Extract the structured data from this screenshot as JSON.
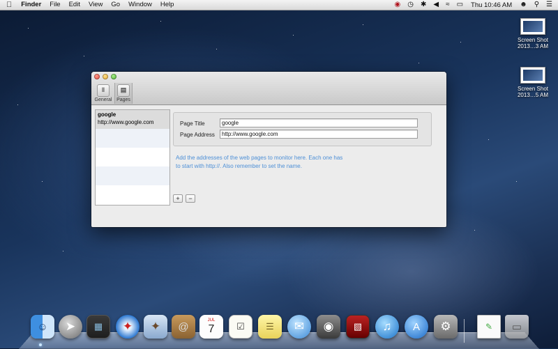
{
  "menubar": {
    "apple": "",
    "app_name": "Finder",
    "items": [
      "File",
      "Edit",
      "View",
      "Go",
      "Window",
      "Help"
    ],
    "clock": "Thu 10:46 AM",
    "status_icons": [
      "eye-icon",
      "time-machine-icon",
      "bluetooth-icon",
      "volume-icon",
      "wifi-icon",
      "battery-icon",
      "user-icon",
      "spotlight-icon",
      "notification-center-icon"
    ]
  },
  "desktop": {
    "icons": [
      {
        "label_line1": "Screen Shot",
        "label_line2": "2013…3 AM"
      },
      {
        "label_line1": "Screen Shot",
        "label_line2": "2013…5 AM"
      }
    ]
  },
  "window": {
    "toolbar": {
      "general_label": "General",
      "pages_label": "Pages"
    },
    "pages": [
      {
        "name": "google",
        "url": "http://www.google.com"
      }
    ],
    "detail": {
      "page_title_label": "Page Title",
      "page_title_value": "google",
      "page_address_label": "Page Address",
      "page_address_value": "http://www.google.com"
    },
    "hint_line1": "Add the addresses of the web pages to monitor here. Each one has",
    "hint_line2": "to start with http://. Also remember to set the name.",
    "add_button": "+",
    "remove_button": "−"
  },
  "dock": {
    "apps": [
      "finder-icon",
      "launchpad-icon",
      "mission-control-icon",
      "safari-icon",
      "mail-icon",
      "contacts-icon",
      "calendar-icon",
      "reminders-icon",
      "notes-icon",
      "messages-icon",
      "facetime-icon",
      "photo-booth-icon",
      "itunes-icon",
      "app-store-icon",
      "system-preferences-icon",
      "document-icon",
      "trash-icon"
    ],
    "calendar_month": "JUL",
    "calendar_day": "7"
  }
}
